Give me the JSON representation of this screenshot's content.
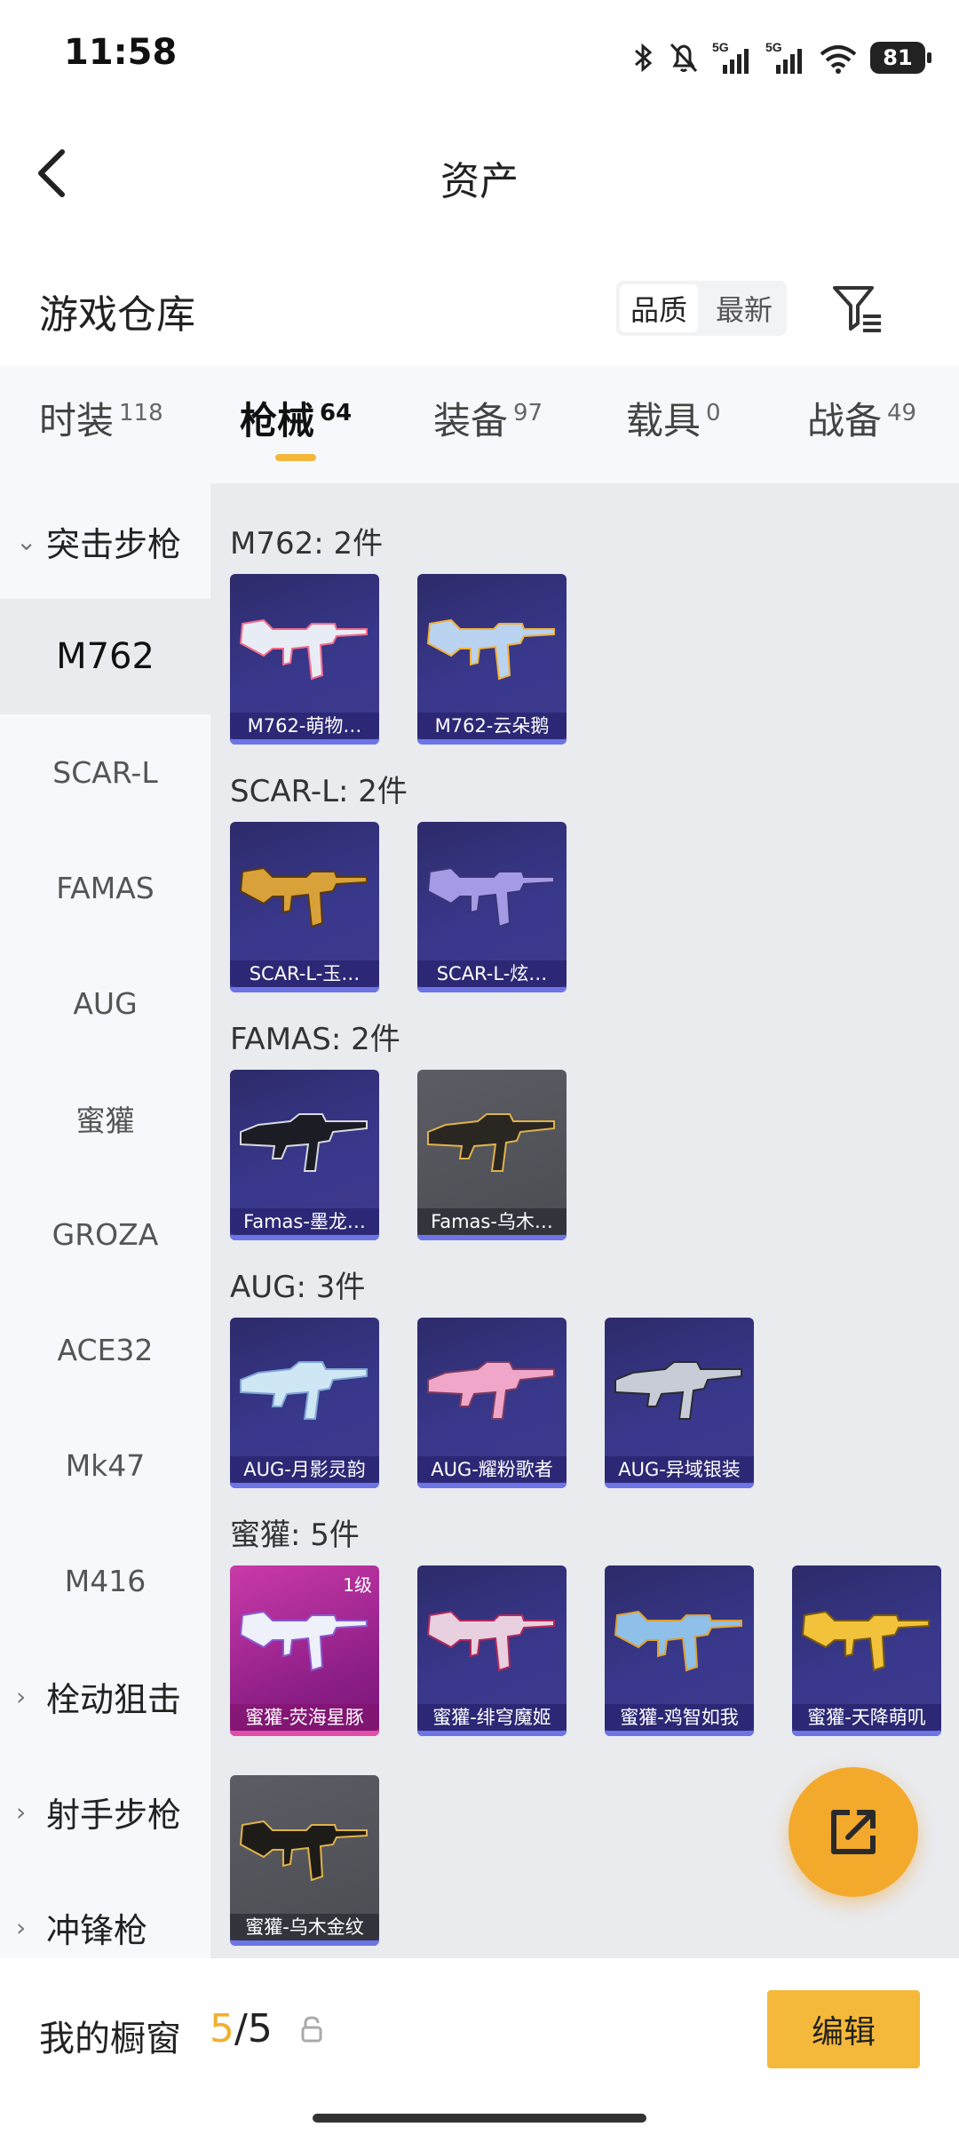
{
  "status_bar": {
    "time": "11:58",
    "battery": "81",
    "signal_labels": [
      "5G",
      "5G"
    ]
  },
  "header": {
    "title": "资产"
  },
  "section": {
    "title": "游戏仓库",
    "sort_options": [
      "品质",
      "最新"
    ]
  },
  "tabs": [
    {
      "label": "时装",
      "count": "118"
    },
    {
      "label": "枪械",
      "count": "64"
    },
    {
      "label": "装备",
      "count": "97"
    },
    {
      "label": "载具",
      "count": "0"
    },
    {
      "label": "战备",
      "count": "49"
    }
  ],
  "sidebar": {
    "categories": [
      "突击步枪",
      "栓动狙击",
      "射手步枪",
      "冲锋枪"
    ],
    "subitems": [
      "M762",
      "SCAR-L",
      "FAMAS",
      "AUG",
      "蜜獾",
      "GROZA",
      "ACE32",
      "Mk47",
      "M416"
    ]
  },
  "groups": [
    {
      "title": "M762: 2件",
      "items": [
        "M762-萌物…",
        "M762-云朵鹅"
      ]
    },
    {
      "title": "SCAR-L: 2件",
      "items": [
        "SCAR-L-玉…",
        "SCAR-L-炫…"
      ]
    },
    {
      "title": "FAMAS: 2件",
      "items": [
        "Famas-墨龙…",
        "Famas-乌木…"
      ]
    },
    {
      "title": "AUG: 3件",
      "items": [
        "AUG-月影灵韵",
        "AUG-耀粉歌者",
        "AUG-异域银装"
      ]
    },
    {
      "title": "蜜獾: 5件",
      "items": [
        "蜜獾-荧海星豚",
        "蜜獾-绯穹魔姬",
        "蜜獾-鸡智如我",
        "蜜獾-天降萌叽",
        "蜜獾-乌木金纹"
      ],
      "level_badge": "1级"
    }
  ],
  "bottom_bar": {
    "label": "我的橱窗",
    "current": "5",
    "total": "/5",
    "edit_label": "编辑"
  },
  "colors": {
    "accent": "#f4b93a",
    "card_bg": "#39388c",
    "highlight_card": "#c93aa8"
  }
}
